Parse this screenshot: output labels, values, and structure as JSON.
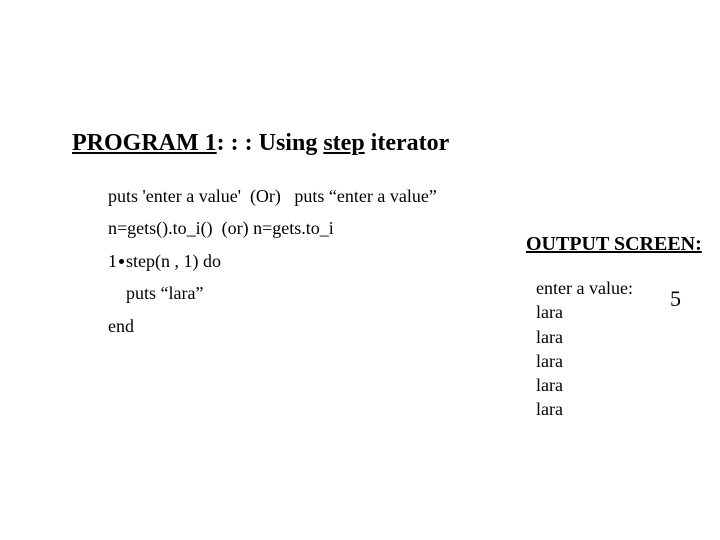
{
  "heading": {
    "prefix": "PROGRAM 1",
    "sep": ": : : Using ",
    "keyword": "step",
    "suffix": " iterator"
  },
  "code": {
    "line1a": "puts 'enter a value'",
    "line1b": "(Or)",
    "line1c": "puts “enter a value”",
    "line2a": "n=gets().to_i()",
    "line2b": "(or)",
    "line2c": "n=gets.to_i",
    "line3a": "1",
    "line3b": "step(n , 1) do",
    "line4": "puts “lara”",
    "line5": "end"
  },
  "output": {
    "heading": "OUTPUT SCREEN:",
    "prompt": "enter a value:",
    "entered": "5",
    "lines": [
      "lara",
      "lara",
      "lara",
      "lara",
      "lara"
    ]
  }
}
